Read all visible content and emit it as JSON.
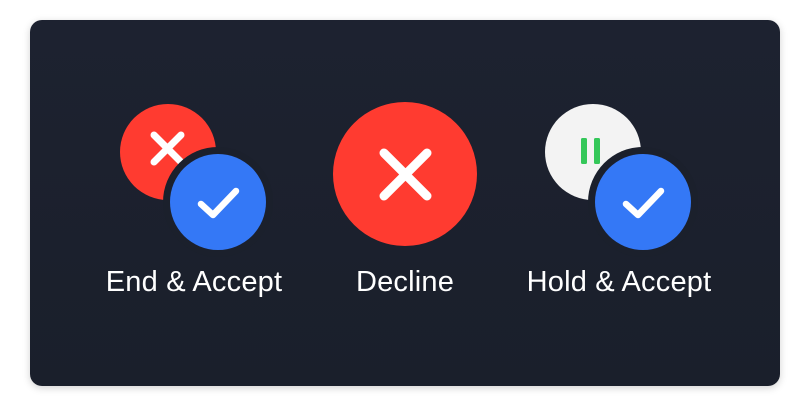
{
  "actions": [
    {
      "id": "end-accept",
      "label": "End & Accept",
      "icons": [
        "close-icon",
        "check-icon"
      ]
    },
    {
      "id": "decline",
      "label": "Decline",
      "icons": [
        "close-icon"
      ]
    },
    {
      "id": "hold-accept",
      "label": "Hold & Accept",
      "icons": [
        "pause-icon",
        "check-icon"
      ]
    }
  ],
  "colors": {
    "panel_bg": "#1c2130",
    "decline_red": "#ff3b30",
    "accept_blue": "#3478f6",
    "hold_white": "#f3f3f3",
    "pause_green": "#34c759",
    "label_text": "#ffffff"
  }
}
